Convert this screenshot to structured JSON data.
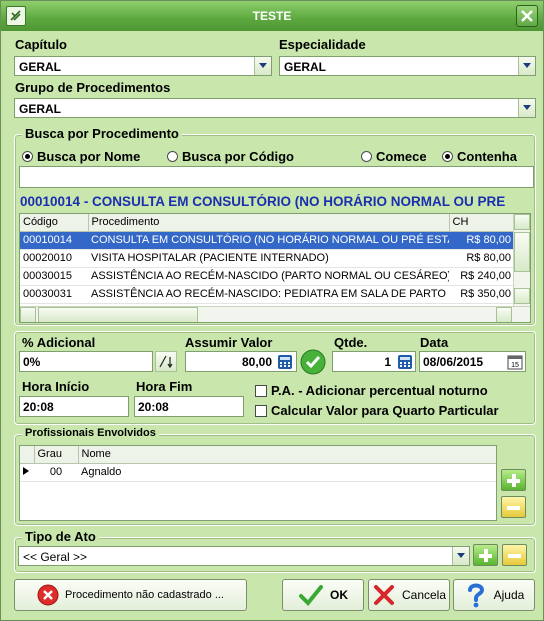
{
  "window": {
    "title": "TESTE"
  },
  "capitulo": {
    "label": "Capítulo",
    "value": "GERAL"
  },
  "especialidade": {
    "label": "Especialidade",
    "value": "GERAL"
  },
  "grupo": {
    "label": "Grupo de Procedimentos",
    "value": "GERAL"
  },
  "busca": {
    "title": "Busca por Procedimento",
    "opt_nome": "Busca por Nome",
    "opt_codigo": "Busca por Código",
    "opt_comece": "Comece",
    "opt_contenha": "Contenha",
    "search_value": ""
  },
  "selected_title": "00010014 - CONSULTA EM CONSULTÓRIO (NO HORÁRIO NORMAL OU PRE",
  "procedures": {
    "headers": [
      "Código",
      "Procedimento",
      "CH"
    ],
    "rows": [
      [
        "00010014",
        "CONSULTA EM CONSULTÓRIO (NO HORÁRIO NORMAL OU PRÉ ESTA",
        "R$ 80,00"
      ],
      [
        "00020010",
        "VISITA HOSPITALAR (PACIENTE INTERNADO)",
        "R$ 80,00"
      ],
      [
        "00030015",
        "ASSISTÊNCIA AO RECÉM-NASCIDO (PARTO NORMAL OU CESÁREO) - A",
        "R$ 240,00"
      ],
      [
        "00030031",
        "ASSISTÊNCIA AO RECÉM-NASCIDO: PEDIATRA EM SALA DE PARTO",
        "R$ 350,00"
      ]
    ]
  },
  "adicional": {
    "label": "% Adicional",
    "value": "0%"
  },
  "assumir": {
    "label": "Assumir Valor",
    "value": "80,00"
  },
  "qtde": {
    "label": "Qtde.",
    "value": "1"
  },
  "data": {
    "label": "Data",
    "value": "08/06/2015"
  },
  "hora_inicio": {
    "label": "Hora Início",
    "value": "20:08"
  },
  "hora_fim": {
    "label": "Hora Fim",
    "value": "20:08"
  },
  "pa_checkbox": "P.A. - Adicionar percentual noturno",
  "quarto_checkbox": "Calcular Valor para Quarto Particular",
  "profissionais": {
    "title": "Profissionais Envolvidos",
    "headers": [
      "Grau",
      "Nome"
    ],
    "rows": [
      [
        "00",
        "Agnaldo"
      ]
    ]
  },
  "tipo_ato": {
    "label": "Tipo de Ato",
    "value": "<< Geral >>"
  },
  "buttons": {
    "nao_cadastrado": "Procedimento não cadastrado ...",
    "ok": "OK",
    "cancela": "Cancela",
    "ajuda": "Ajuda"
  }
}
